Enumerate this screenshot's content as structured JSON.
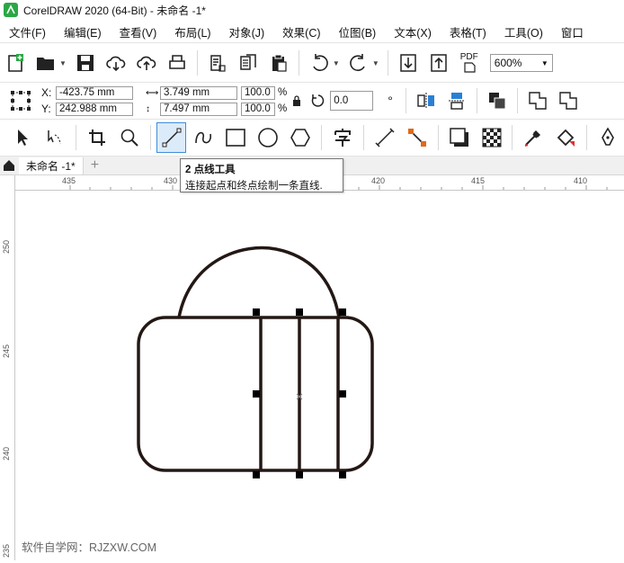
{
  "window": {
    "title": "CorelDRAW 2020 (64-Bit) - 未命名 -1*"
  },
  "menu": [
    "文件(F)",
    "编辑(E)",
    "查看(V)",
    "布局(L)",
    "对象(J)",
    "效果(C)",
    "位图(B)",
    "文本(X)",
    "表格(T)",
    "工具(O)",
    "窗口"
  ],
  "toolbar": {
    "zoom_value": "600%",
    "pdf_label": "PDF"
  },
  "properties": {
    "x_label": "X:",
    "x_value": "-423.75 mm",
    "y_label": "Y:",
    "y_value": "242.988 mm",
    "width_value": "3.749 mm",
    "height_value": "7.497 mm",
    "scale_w": "100.0",
    "scale_h": "100.0",
    "percent": "%",
    "rotation_value": "0.0",
    "degree_symbol": "°"
  },
  "tabs": {
    "document": "未命名 -1*",
    "add": "+"
  },
  "ruler": {
    "top_ticks": [
      "435",
      "430",
      "420",
      "415",
      "410"
    ],
    "left_ticks": [
      "250",
      "245",
      "240",
      "235"
    ]
  },
  "tooltip": {
    "title": "2 点线工具",
    "description": "连接起点和终点绘制一条直线."
  },
  "watermark": "软件自学网：RJZXW.COM",
  "colors": {
    "accent": "#3d8edc",
    "shape_stroke": "#231815",
    "handle": "#000000"
  }
}
